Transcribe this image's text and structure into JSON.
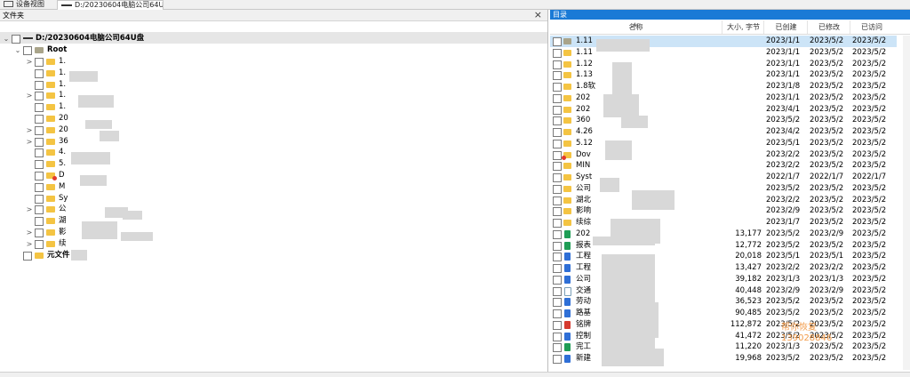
{
  "tabs": [
    {
      "label": "设备视图"
    },
    {
      "label": "D:/20230604电脑公司64U盘"
    }
  ],
  "left_pane": {
    "title": "文件夹",
    "close": "×",
    "drive": "D:/20230604电脑公司64U盘",
    "root": "Root",
    "children": [
      {
        "label": "1.",
        "expand": ">",
        "icon": "folder"
      },
      {
        "label": "1.",
        "expand": "",
        "icon": "folder"
      },
      {
        "label": "1.",
        "expand": "",
        "icon": "folder"
      },
      {
        "label": "1.",
        "expand": ">",
        "icon": "folder"
      },
      {
        "label": "1.",
        "expand": "",
        "icon": "folder"
      },
      {
        "label": "20",
        "expand": "",
        "icon": "folder"
      },
      {
        "label": "20",
        "expand": ">",
        "icon": "folder"
      },
      {
        "label": "36",
        "expand": ">",
        "icon": "folder"
      },
      {
        "label": "4.",
        "expand": "",
        "icon": "folder"
      },
      {
        "label": "5.",
        "expand": "",
        "icon": "folder"
      },
      {
        "label": "D",
        "expand": "",
        "icon": "folder-red"
      },
      {
        "label": "M",
        "expand": "",
        "icon": "folder"
      },
      {
        "label": "Sy",
        "expand": "",
        "icon": "folder"
      },
      {
        "label": "公",
        "expand": ">",
        "icon": "folder"
      },
      {
        "label": "湖",
        "expand": "",
        "icon": "folder"
      },
      {
        "label": "影",
        "expand": ">",
        "icon": "folder"
      },
      {
        "label": "续",
        "expand": ">",
        "icon": "folder"
      }
    ],
    "meta": "元文件"
  },
  "right_pane": {
    "title": "目录",
    "columns": {
      "name": "名称",
      "size": "大小, 字节",
      "created": "已创建",
      "modified": "已修改",
      "accessed": "已访问"
    },
    "rows": [
      {
        "name": "1.11",
        "icon": "folder-grey",
        "size": "",
        "created": "2023/1/1",
        "modified": "2023/5/2",
        "accessed": "2023/5/2",
        "selected": true
      },
      {
        "name": "1.11",
        "icon": "folder",
        "size": "",
        "created": "2023/1/1",
        "modified": "2023/5/2",
        "accessed": "2023/5/2"
      },
      {
        "name": "1.12",
        "icon": "folder",
        "size": "",
        "created": "2023/1/1",
        "modified": "2023/5/2",
        "accessed": "2023/5/2"
      },
      {
        "name": "1.13",
        "icon": "folder",
        "size": "",
        "created": "2023/1/1",
        "modified": "2023/5/2",
        "accessed": "2023/5/2"
      },
      {
        "name": "1.8软",
        "icon": "folder",
        "size": "",
        "created": "2023/1/8",
        "modified": "2023/5/2",
        "accessed": "2023/5/2"
      },
      {
        "name": "202",
        "icon": "folder",
        "size": "",
        "created": "2023/1/1",
        "modified": "2023/5/2",
        "accessed": "2023/5/2"
      },
      {
        "name": "202",
        "icon": "folder",
        "size": "",
        "created": "2023/4/1",
        "modified": "2023/5/2",
        "accessed": "2023/5/2"
      },
      {
        "name": "360",
        "icon": "folder",
        "size": "",
        "created": "2023/5/2",
        "modified": "2023/5/2",
        "accessed": "2023/5/2"
      },
      {
        "name": "4.26",
        "icon": "folder",
        "size": "",
        "created": "2023/4/2",
        "modified": "2023/5/2",
        "accessed": "2023/5/2"
      },
      {
        "name": "5.12",
        "icon": "folder",
        "size": "",
        "created": "2023/5/1",
        "modified": "2023/5/2",
        "accessed": "2023/5/2"
      },
      {
        "name": "Dov",
        "icon": "folder-red",
        "size": "",
        "created": "2023/2/2",
        "modified": "2023/5/2",
        "accessed": "2023/5/2"
      },
      {
        "name": "MIN",
        "icon": "folder",
        "size": "",
        "created": "2023/2/2",
        "modified": "2023/5/2",
        "accessed": "2023/5/2"
      },
      {
        "name": "Syst",
        "icon": "folder",
        "size": "",
        "created": "2022/1/7",
        "modified": "2022/1/7",
        "accessed": "2022/1/7"
      },
      {
        "name": "公司",
        "icon": "folder",
        "size": "",
        "created": "2023/5/2",
        "modified": "2023/5/2",
        "accessed": "2023/5/2"
      },
      {
        "name": "湖北",
        "icon": "folder",
        "size": "",
        "created": "2023/2/2",
        "modified": "2023/5/2",
        "accessed": "2023/5/2"
      },
      {
        "name": "影响",
        "icon": "folder",
        "size": "",
        "created": "2023/2/9",
        "modified": "2023/5/2",
        "accessed": "2023/5/2"
      },
      {
        "name": "续综",
        "icon": "folder",
        "size": "",
        "created": "2023/1/7",
        "modified": "2023/5/2",
        "accessed": "2023/5/2"
      },
      {
        "name": "202",
        "icon": "xls",
        "size": "13,177",
        "created": "2023/5/2",
        "modified": "2023/2/9",
        "accessed": "2023/5/2"
      },
      {
        "name": "报表",
        "icon": "xls",
        "size": "12,772",
        "created": "2023/5/2",
        "modified": "2023/5/2",
        "accessed": "2023/5/2"
      },
      {
        "name": "工程",
        "icon": "doc",
        "size": "20,018",
        "created": "2023/5/1",
        "modified": "2023/5/1",
        "accessed": "2023/5/2"
      },
      {
        "name": "工程",
        "icon": "doc",
        "size": "13,427",
        "created": "2023/2/2",
        "modified": "2023/2/2",
        "accessed": "2023/5/2"
      },
      {
        "name": "公司",
        "icon": "doc",
        "size": "39,182",
        "created": "2023/1/3",
        "modified": "2023/1/3",
        "accessed": "2023/5/2"
      },
      {
        "name": "交通",
        "icon": "txt",
        "size": "40,448",
        "created": "2023/2/9",
        "modified": "2023/2/9",
        "accessed": "2023/5/2"
      },
      {
        "name": "劳动",
        "icon": "doc",
        "size": "36,523",
        "created": "2023/5/2",
        "modified": "2023/5/2",
        "accessed": "2023/5/2"
      },
      {
        "name": "路基",
        "icon": "doc",
        "size": "90,485",
        "created": "2023/5/2",
        "modified": "2023/5/2",
        "accessed": "2023/5/2"
      },
      {
        "name": "铭牌",
        "icon": "pdf",
        "size": "112,872",
        "created": "2023/5/2",
        "modified": "2023/5/2",
        "accessed": "2023/5/2"
      },
      {
        "name": "控制",
        "icon": "doc",
        "size": "41,472",
        "created": "2023/5/2",
        "modified": "2023/5/2",
        "accessed": "2023/5/2"
      },
      {
        "name": "完工",
        "icon": "xls",
        "size": "11,220",
        "created": "2023/1/3",
        "modified": "2023/5/2",
        "accessed": "2023/5/2"
      },
      {
        "name": "新建",
        "icon": "doc",
        "size": "19,968",
        "created": "2023/5/2",
        "modified": "2023/5/2",
        "accessed": "2023/5/2"
      }
    ],
    "watermark_line1": "帮你恢复",
    "watermark_line2": "139028846"
  },
  "colors": {
    "accent": "#1a7ad6",
    "folder": "#f4c443",
    "selection": "#cce4f7"
  }
}
